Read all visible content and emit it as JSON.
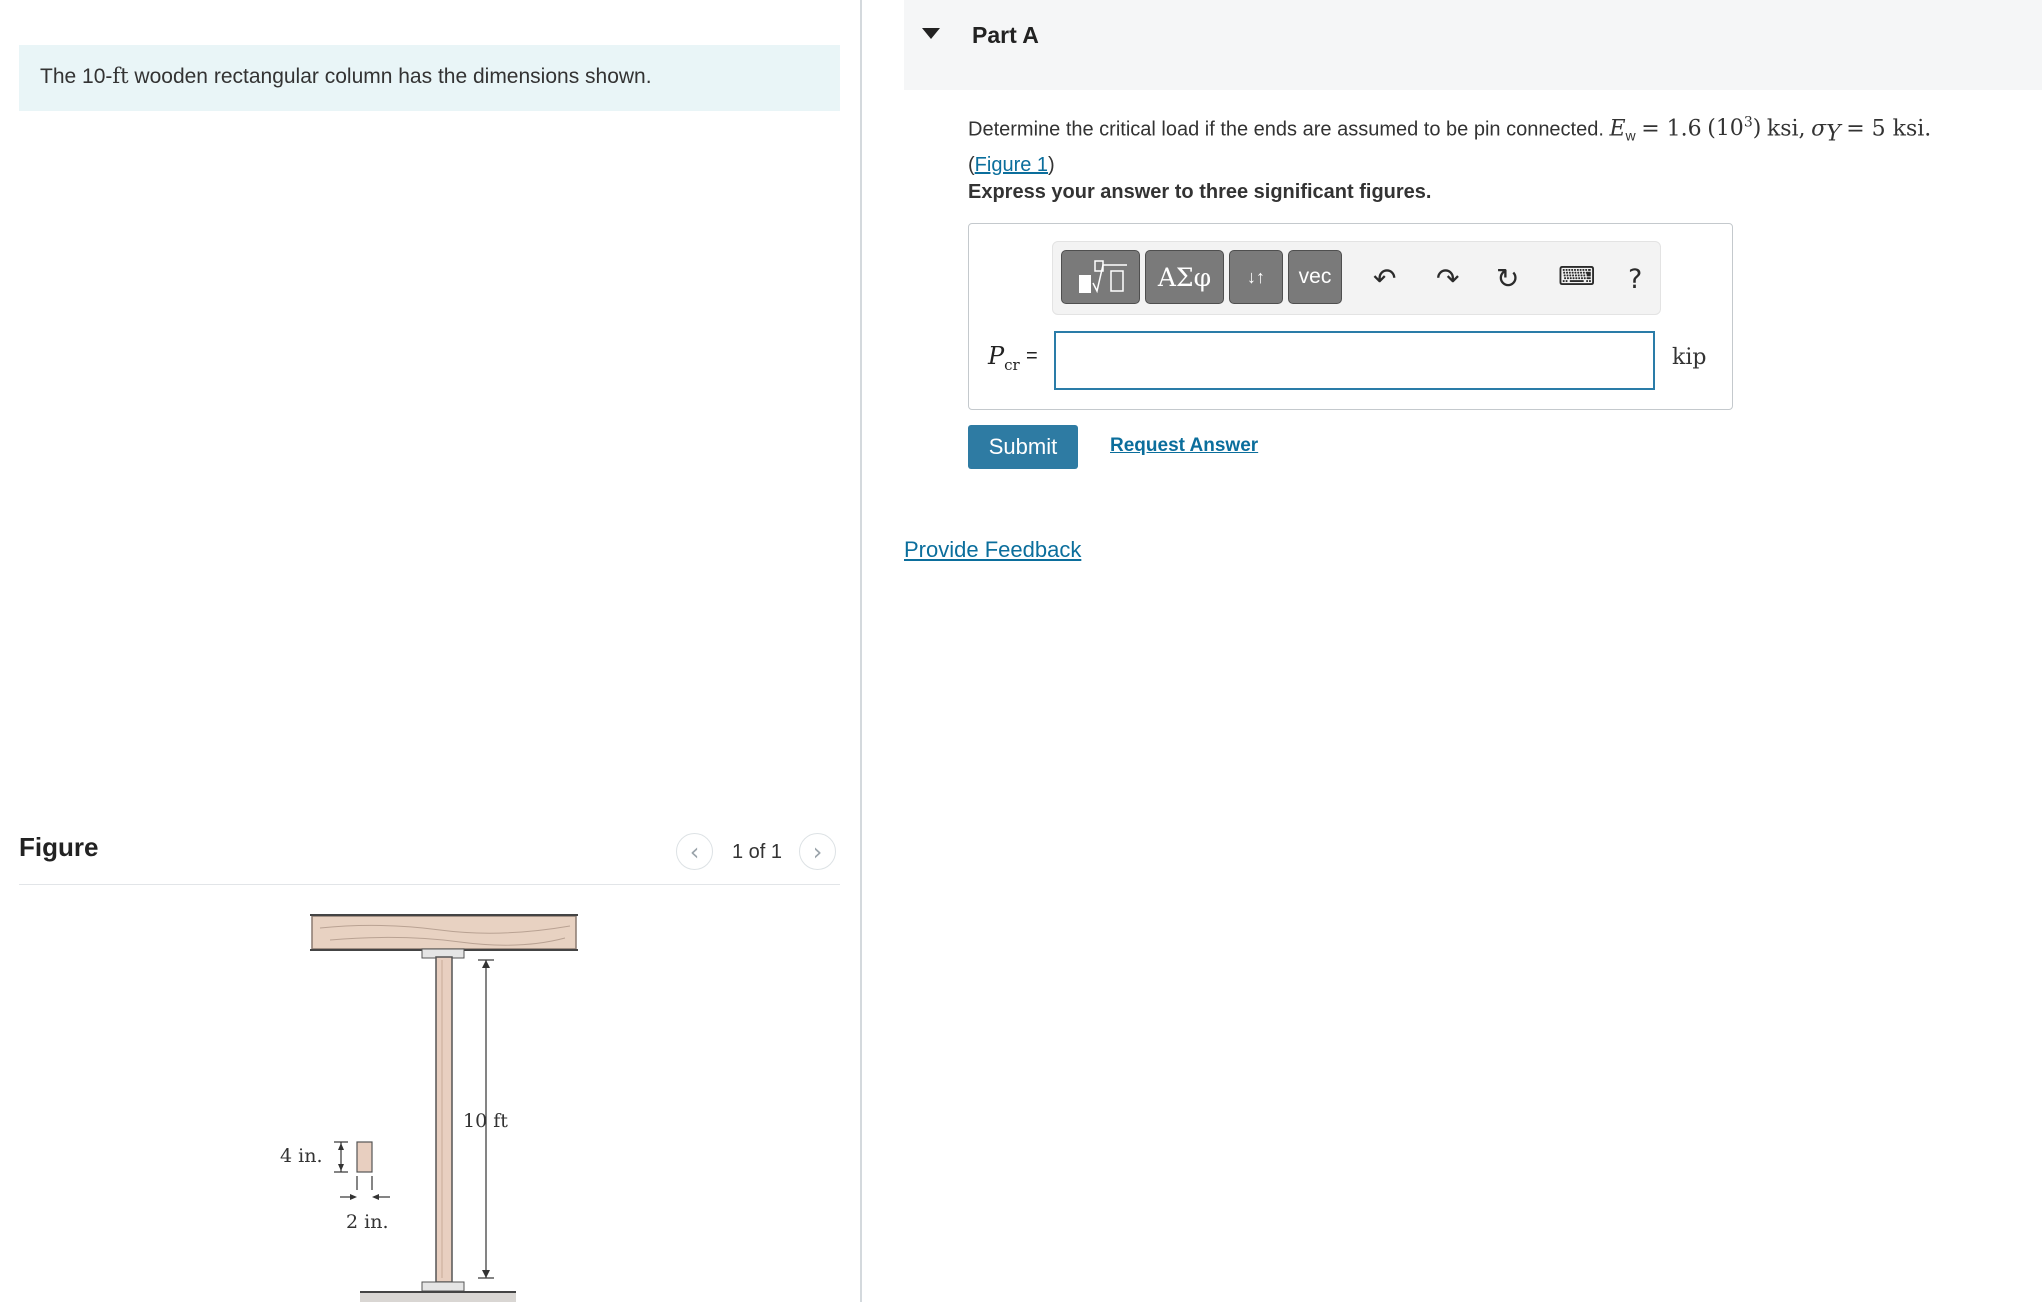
{
  "problem": {
    "intro_before": "The 10-",
    "intro_unit": "ft",
    "intro_after": " wooden rectangular column has the dimensions shown."
  },
  "figure": {
    "title": "Figure",
    "counter": "1 of 1",
    "prev_icon": "chevron-left-icon",
    "next_icon": "chevron-right-icon",
    "labels": {
      "height": "10 ft",
      "depth": "4 in.",
      "width": "2 in."
    }
  },
  "part": {
    "title": "Part A",
    "question_text": "Determine the critical load if the ends are assumed to be pin connected.",
    "e_symbol": "E",
    "e_sub": "w",
    "e_value": "= 1.6",
    "e_pow_base": "10",
    "e_pow_exp": "3",
    "e_unit": "ksi,",
    "sigma_symbol": "σ",
    "sigma_sub": "Y",
    "sigma_value": "= 5 ksi.",
    "figure_link": "Figure 1",
    "instruction": "Express your answer to three significant figures."
  },
  "answer": {
    "label": "P",
    "label_sub": "cr",
    "equals": "=",
    "value": "",
    "unit": "kip",
    "toolbar": {
      "templates_icon": "templates-icon",
      "greek": "ΑΣφ",
      "arrows": "↓↑",
      "vec": "vec",
      "undo_icon": "undo-icon",
      "redo_icon": "redo-icon",
      "reset_icon": "reset-icon",
      "keyboard_icon": "keyboard-icon",
      "help": "?"
    }
  },
  "actions": {
    "submit": "Submit",
    "request_answer": "Request Answer",
    "feedback": "Provide Feedback"
  },
  "colors": {
    "accent": "#2e7ba3",
    "link": "#0b6e9c",
    "intro_bg": "#e9f5f7",
    "wood": "#e8cfc0"
  }
}
